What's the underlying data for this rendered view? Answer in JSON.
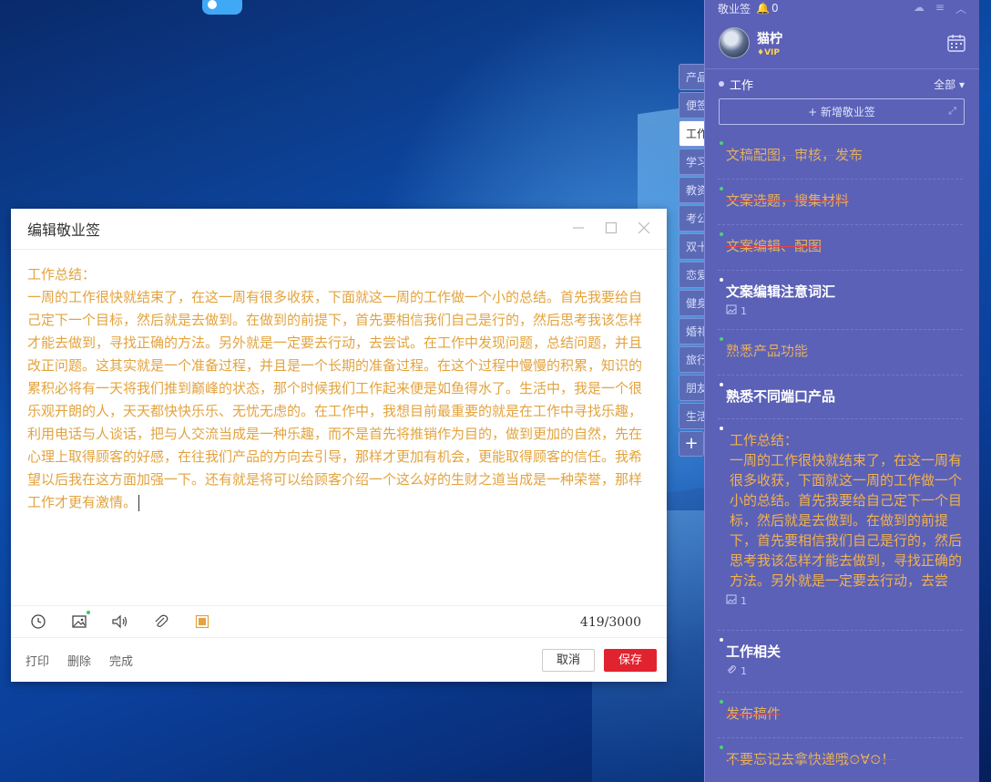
{
  "desktop": {
    "beam_color": "#8fd3ff"
  },
  "tabs": {
    "items": [
      "产品",
      "便签",
      "工作",
      "学习",
      "教资",
      "考公",
      "双十",
      "恋爱",
      "健身",
      "婚礼",
      "旅行",
      "朋友",
      "生活"
    ],
    "active_index": 2,
    "add_label": "+"
  },
  "editor": {
    "title": "编辑敬业签",
    "body_text": "工作总结：\n一周的工作很快就结束了，在这一周有很多收获，下面就这一周的工作做一个小的总结。首先我要给自己定下一个目标，然后就是去做到。在做到的前提下，首先要相信我们自己是行的，然后思考我该怎样才能去做到，寻找正确的方法。另外就是一定要去行动，去尝试。在工作中发现问题，总结问题，并且改正问题。这其实就是一个准备过程，并且是一个长期的准备过程。在这个过程中慢慢的积累，知识的累积必将有一天将我们推到巅峰的状态，那个时候我们工作起来便是如鱼得水了。生活中，我是一个很乐观开朗的人，天天都快快乐乐、无忧无虑的。在工作中，我想目前最重要的就是在工作中寻找乐趣，利用电话与人谈话，把与人交流当成是一种乐趣，而不是首先将推销作为目的，做到更加的自然，先在心理上取得顾客的好感，在往我们产品的方向去引导，那样才更加有机会，更能取得顾客的信任。我希望以后我在这方面加强一下。还有就是将可以给顾客介绍一个这么好的生财之道当成是一种荣誉，那样工作才更有激情。",
    "text_color": "#e3a33e",
    "counter": "419/3000",
    "footer": {
      "print": "打印",
      "delete": "删除",
      "done": "完成",
      "cancel": "取消",
      "save": "保存"
    },
    "save_color": "#e0232e"
  },
  "panel": {
    "app_name": "敬业签",
    "notif_count": "0",
    "bg_color": "#5b61b6",
    "user": {
      "name": "猫柠",
      "badge": "VIP"
    },
    "category": {
      "name": "工作",
      "filter": "全部"
    },
    "add_note_label": "+ 新增敬业签",
    "notes": [
      {
        "text": "文稿配图，审核，发布",
        "done": true
      },
      {
        "text": "文案选题，搜集材料",
        "done": true
      },
      {
        "text": "文案编辑、配图",
        "done": true
      },
      {
        "text": "文案编辑注意词汇",
        "done": false,
        "meta_icon": "image-icon",
        "meta_count": "1"
      },
      {
        "text": "熟悉产品功能",
        "done": true
      },
      {
        "text": "熟悉不同端口产品",
        "done": false
      },
      {
        "text": "工作总结：\n一周的工作很快就结束了，在这一周有很多收获，下面就这一周的工作做一个小的总结。首先我要给自己定下一个目标，然后就是去做到。在做到的前提下，首先要相信我们自己是行的，然后思考我该怎样才能去做到，寻找正确的方法。另外就是一定要去行动，去尝试。",
        "done": false,
        "long": true,
        "meta_icon": "image-icon",
        "meta_count": "1"
      },
      {
        "text": "工作相关",
        "done": false,
        "meta_icon": "paperclip-icon",
        "meta_count": "1"
      },
      {
        "text": "发布稿件",
        "done": true
      },
      {
        "text": "不要忘记去拿快递哦⊙∀⊙！",
        "done": true
      }
    ],
    "strike_color": "#e4434a",
    "done_text_color": "#e4b263"
  }
}
